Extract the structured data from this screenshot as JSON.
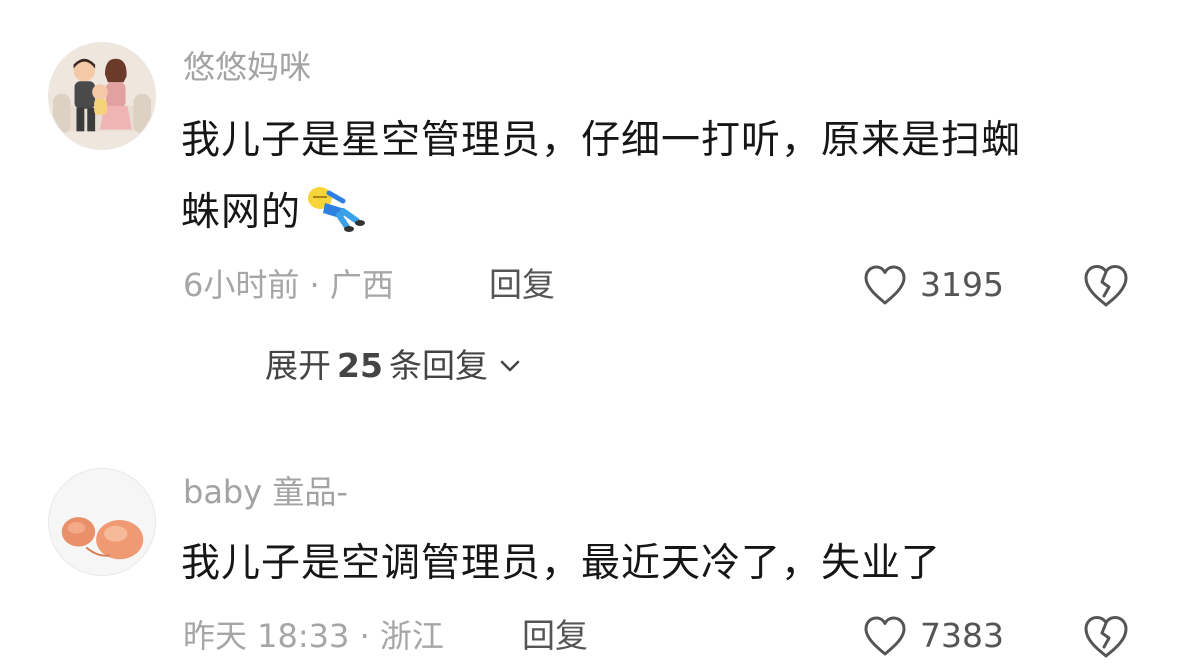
{
  "comments": [
    {
      "username": "悠悠妈咪",
      "text_line1": "我儿子是星空管理员，仔细一打听，原来是扫蜘",
      "text_line2": "蛛网的",
      "emoji": "lying-figure-emoji",
      "time": "6小时前",
      "location": "广西",
      "meta_separator": "·",
      "reply_label": "回复",
      "likes": "3195",
      "expand_prefix": "展开",
      "expand_count": "25",
      "expand_suffix": "条回复"
    },
    {
      "username": "baby 童品-",
      "text_line1": "我儿子是空调管理员，最近天冷了，失业了",
      "time": "昨天 18:33",
      "location": "浙江",
      "meta_separator": "·",
      "reply_label": "回复",
      "likes": "7383"
    }
  ],
  "icons": {
    "like": "heart-outline-icon",
    "dislike": "broken-heart-icon",
    "expand": "chevron-down-icon"
  },
  "colors": {
    "text_primary": "#161616",
    "text_secondary": "#a6a6a6",
    "icon": "#555555"
  }
}
